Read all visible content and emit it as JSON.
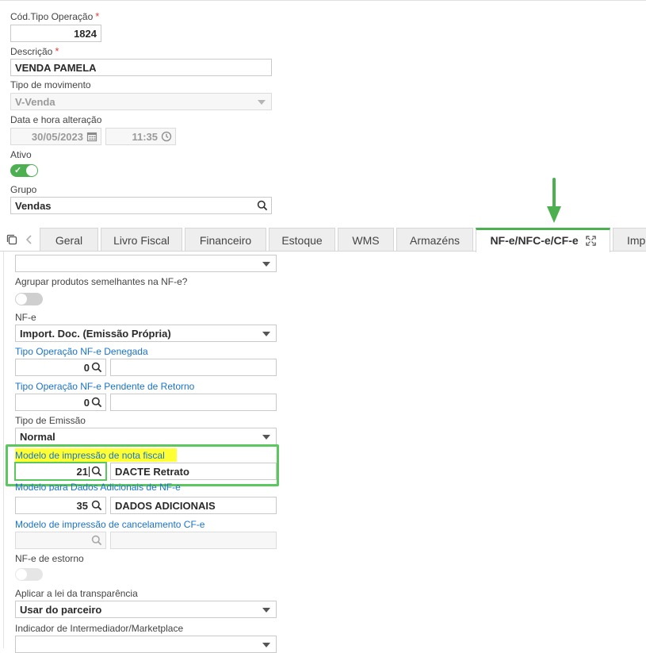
{
  "header": {
    "cod_tipo_label": "Cód.Tipo Operação",
    "cod_tipo_value": "1824",
    "descricao_label": "Descrição",
    "descricao_value": "VENDA PAMELA",
    "tipo_mov_label": "Tipo de movimento",
    "tipo_mov_value": "V-Venda",
    "data_label": "Data e hora alteração",
    "data_value": "30/05/2023",
    "hora_value": "11:35",
    "ativo_label": "Ativo",
    "grupo_label": "Grupo",
    "grupo_value": "Vendas",
    "required_mark": "*"
  },
  "tabs": [
    {
      "label": "Geral"
    },
    {
      "label": "Livro Fiscal"
    },
    {
      "label": "Financeiro"
    },
    {
      "label": "Estoque"
    },
    {
      "label": "WMS"
    },
    {
      "label": "Armazéns"
    },
    {
      "label": "NF-e/NFC-e/CF-e"
    },
    {
      "label": "Impo"
    }
  ],
  "form": {
    "agrupar_label": "Agrupar produtos semelhantes na NF-e?",
    "nfe_label": "NF-e",
    "nfe_value": "Import. Doc. (Emissão Própria)",
    "denegada_label": "Tipo Operação NF-e Denegada",
    "denegada_code": "0",
    "pendente_label": "Tipo Operação NF-e Pendente de Retorno",
    "pendente_code": "0",
    "emissao_label": "Tipo de Emissão",
    "emissao_value": "Normal",
    "modelo_label": "Modelo de impressão de nota fiscal",
    "modelo_code": "21",
    "modelo_desc": "DACTE Retrato",
    "adicionais_label": "Modelo para Dados Adicionais de NF-e",
    "adicionais_code": "35",
    "adicionais_desc": "DADOS ADICIONAIS",
    "cancel_label": "Modelo de impressão de cancelamento CF-e",
    "estorno_label": "NF-e de estorno",
    "transp_label": "Aplicar a lei da transparência",
    "transp_value": "Usar do parceiro",
    "intermed_label": "Indicador de Intermediador/Marketplace"
  },
  "colors": {
    "accent_green": "#4caf50",
    "highlight_yellow": "#ffff33",
    "link_blue": "#1a73c8"
  }
}
